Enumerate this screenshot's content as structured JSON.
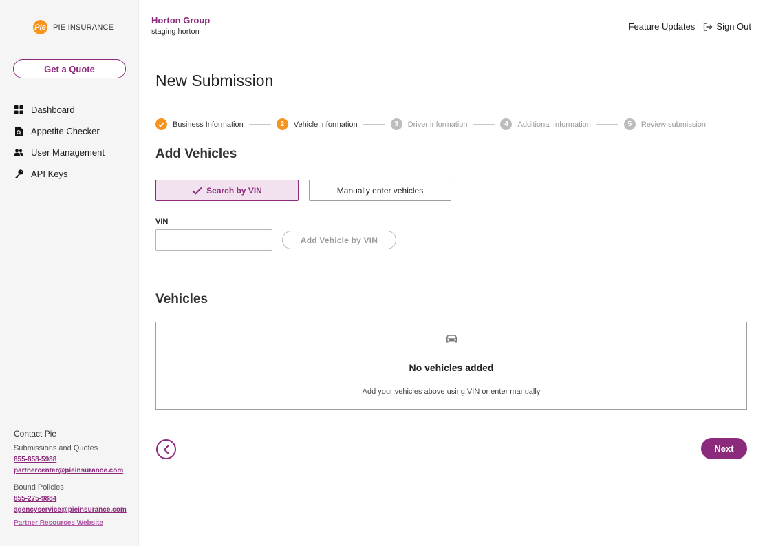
{
  "brand": {
    "logo_mark": "Pie",
    "logo_text": "PIE INSURANCE",
    "accent": "#8c2a7c",
    "orange": "#f7941d"
  },
  "sidebar": {
    "quote_button": "Get a Quote",
    "items": [
      {
        "label": "Dashboard",
        "icon": "grid-icon"
      },
      {
        "label": "Appetite Checker",
        "icon": "search-document-icon"
      },
      {
        "label": "User Management",
        "icon": "users-icon"
      },
      {
        "label": "API Keys",
        "icon": "key-icon"
      }
    ],
    "contact": {
      "heading": "Contact Pie",
      "submissions_label": "Submissions and Quotes",
      "submissions_phone": "855-858-5988",
      "submissions_email": "partnercenter@pieinsurance.com",
      "bound_label": "Bound Policies",
      "bound_phone": "855-275-9884",
      "bound_email": "agencyservice@pieinsurance.com",
      "partner_link": "Partner Resources Website"
    }
  },
  "header": {
    "org_name": "Horton Group",
    "org_sub": "staging horton",
    "feature_updates": "Feature Updates",
    "sign_out": "Sign Out"
  },
  "main": {
    "title": "New Submission",
    "steps": [
      {
        "num": "✓",
        "label": "Business Information",
        "state": "done"
      },
      {
        "num": "2",
        "label": "Vehicle information",
        "state": "active"
      },
      {
        "num": "3",
        "label": "Driver information",
        "state": "todo"
      },
      {
        "num": "4",
        "label": "Additional Information",
        "state": "todo"
      },
      {
        "num": "5",
        "label": "Review submission",
        "state": "todo"
      }
    ],
    "add_vehicles_title": "Add Vehicles",
    "tab_vin": "Search by VIN",
    "tab_manual": "Manually enter vehicles",
    "vin_label": "VIN",
    "vin_value": "",
    "add_vin_button": "Add Vehicle by VIN",
    "vehicles_title": "Vehicles",
    "empty_title": "No vehicles added",
    "empty_sub": "Add your vehicles above using VIN or enter manually",
    "next_button": "Next"
  }
}
